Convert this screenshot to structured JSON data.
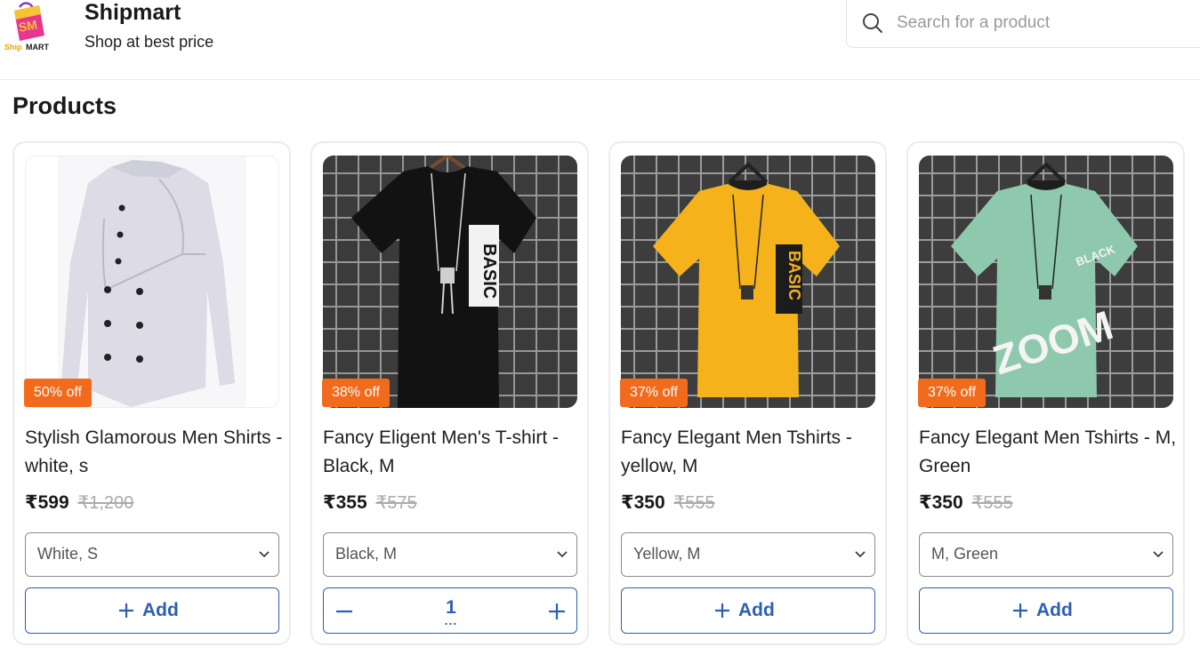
{
  "brand": {
    "logo_text_top": "SM",
    "logo_text_ship": "Ship",
    "logo_text_mart": "MART",
    "title": "Shipmart",
    "subtitle": "Shop at best price"
  },
  "search": {
    "placeholder": "Search for a product",
    "icon": "search-icon"
  },
  "section_title": "Products",
  "colors": {
    "accent": "#2e5fb5",
    "badge": "#f26b1d"
  },
  "products": [
    {
      "badge": "50% off",
      "title": "Stylish Glamorous Men Shirts - white, s",
      "price": "₹599",
      "mrp": "₹1,200",
      "variant": "White, S",
      "add_label": "Add",
      "image": "white-shirt"
    },
    {
      "badge": "38% off",
      "title": "Fancy Eligent Men's T-shirt - Black, M",
      "price": "₹355",
      "mrp": "₹575",
      "variant": "Black, M",
      "quantity": "1",
      "quantity_dots": "...",
      "image": "black-tshirt"
    },
    {
      "badge": "37% off",
      "title": "Fancy Elegant Men Tshirts - yellow, M",
      "price": "₹350",
      "mrp": "₹555",
      "variant": "Yellow, M",
      "add_label": "Add",
      "image": "yellow-tshirt"
    },
    {
      "badge": "37% off",
      "title": "Fancy Elegant Men Tshirts - M, Green",
      "price": "₹350",
      "mrp": "₹555",
      "variant": "M, Green",
      "add_label": "Add",
      "image": "green-tshirt"
    }
  ]
}
